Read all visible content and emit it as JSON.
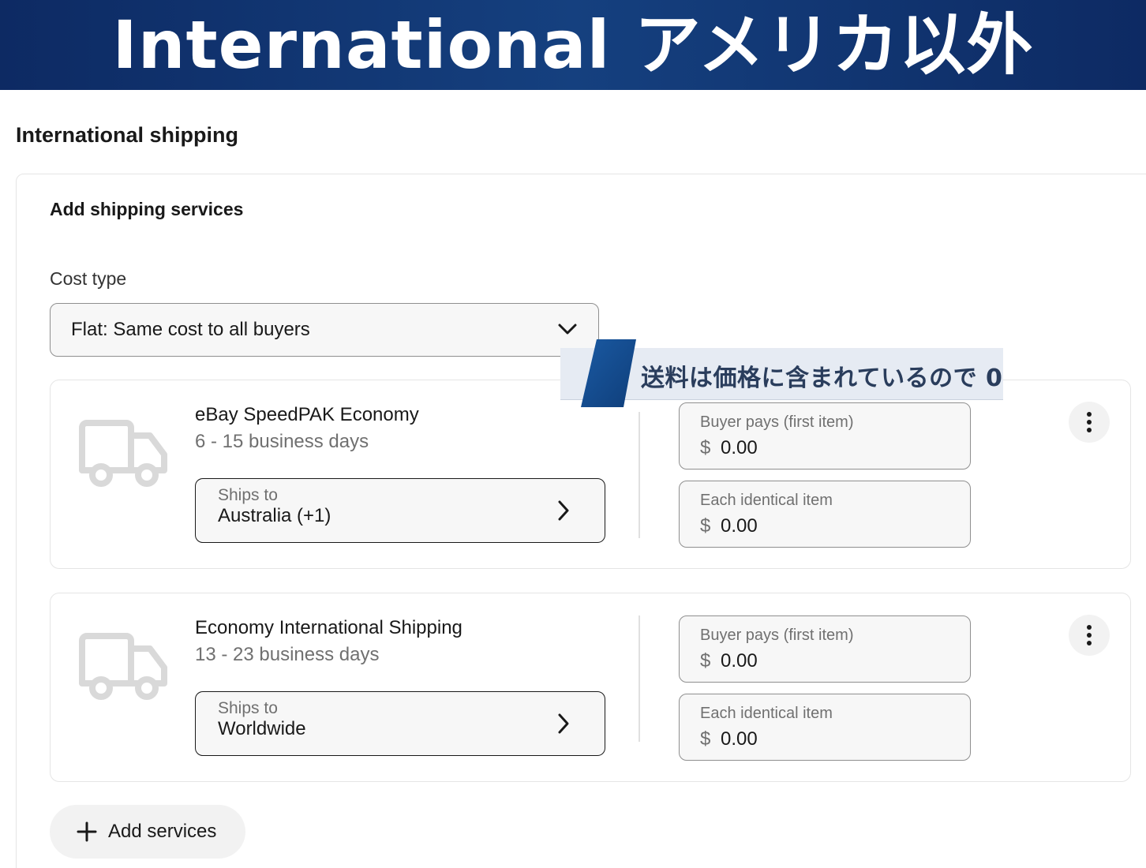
{
  "banner": {
    "title": "International アメリカ以外"
  },
  "section": {
    "title": "International shipping"
  },
  "panel": {
    "title": "Add shipping services",
    "cost_type_label": "Cost type",
    "cost_type_value": "Flat: Same cost to all buyers"
  },
  "callout": {
    "text": "送料は価格に含まれているので 0"
  },
  "services": [
    {
      "name": "eBay SpeedPAK Economy",
      "days": "6 - 15 business days",
      "ships_to_label": "Ships to",
      "ships_to_value": "Australia (+1)",
      "buyer_pays_label": "Buyer pays (first item)",
      "buyer_pays_currency": "$",
      "buyer_pays_value": "0.00",
      "each_item_label": "Each identical item",
      "each_item_currency": "$",
      "each_item_value": "0.00"
    },
    {
      "name": "Economy International Shipping",
      "days": "13 - 23 business days",
      "ships_to_label": "Ships to",
      "ships_to_value": "Worldwide",
      "buyer_pays_label": "Buyer pays (first item)",
      "buyer_pays_currency": "$",
      "buyer_pays_value": "0.00",
      "each_item_label": "Each identical item",
      "each_item_currency": "$",
      "each_item_value": "0.00"
    }
  ],
  "add_services": {
    "label": "Add services"
  },
  "icons": {
    "truck": "truck-icon",
    "select_chevron": "chevron-down-icon",
    "ships_chevron": "chevron-right-icon",
    "more": "more-vertical-icon",
    "add": "plus-icon"
  },
  "colors": {
    "banner_start": "#0d2a63",
    "banner_mid": "#15407f",
    "callout_stripe": "#1a4f8f",
    "callout_bg": "#e6ebf3",
    "text": "#191919",
    "muted": "#707070"
  }
}
